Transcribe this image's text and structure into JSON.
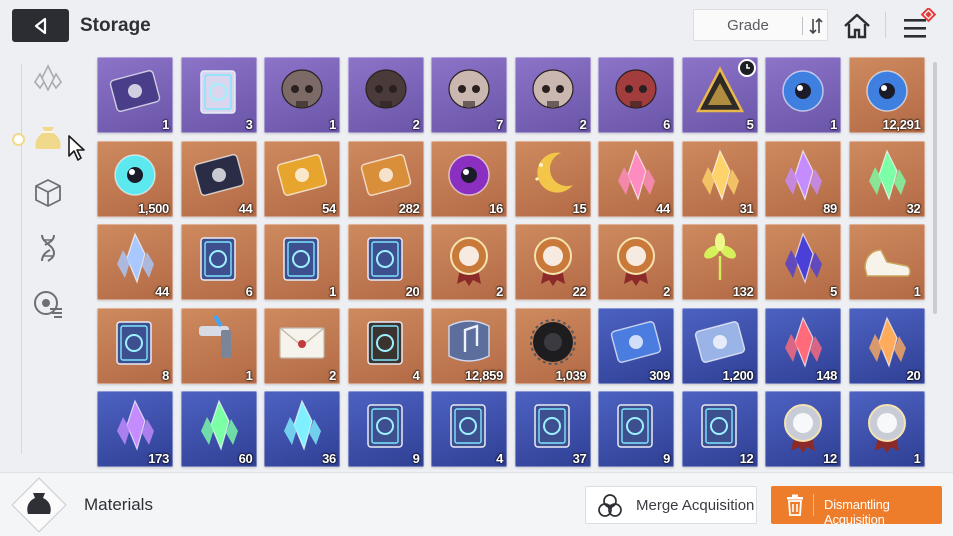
{
  "header": {
    "title": "Storage",
    "back_icon": "back-arrow-icon",
    "grade_label": "Grade",
    "sort_icon": "sort-arrows-icon",
    "home_icon": "home-icon",
    "menu_icon": "hamburger-menu-icon"
  },
  "sidebar": {
    "categories": [
      {
        "name": "crystal-category",
        "icon": "crystal-icon",
        "active": false
      },
      {
        "name": "materials-category",
        "icon": "pouch-icon",
        "active": true
      },
      {
        "name": "cube-category",
        "icon": "cube-icon",
        "active": false
      },
      {
        "name": "dna-category",
        "icon": "dna-icon",
        "active": false
      },
      {
        "name": "module-category",
        "icon": "disc-icon",
        "active": false
      }
    ]
  },
  "colors": {
    "purple": "#7a63b8",
    "orange": "#c17a52",
    "blue": "#3e51ab",
    "accent_orange": "#ee7d2b"
  },
  "items": [
    {
      "icon": "eye-card-icon",
      "grade": "purple",
      "count": "1"
    },
    {
      "icon": "blueprint-book-icon",
      "grade": "purple",
      "count": "3"
    },
    {
      "icon": "mech-head-icon",
      "grade": "purple",
      "count": "1"
    },
    {
      "icon": "brain-icon",
      "grade": "purple",
      "count": "2"
    },
    {
      "icon": "monster-skull-icon",
      "grade": "purple",
      "count": "7"
    },
    {
      "icon": "flesh-head-icon",
      "grade": "purple",
      "count": "2"
    },
    {
      "icon": "red-organ-icon",
      "grade": "purple",
      "count": "6"
    },
    {
      "icon": "pyramid-device-icon",
      "grade": "purple",
      "count": "5",
      "timer": true
    },
    {
      "icon": "eyeball-skull-icon",
      "grade": "purple",
      "count": "1"
    },
    {
      "icon": "blue-orb-creature-icon",
      "grade": "orange",
      "count": "12,291"
    },
    {
      "icon": "cyan-sphere-icon",
      "grade": "orange",
      "count": "1,500"
    },
    {
      "icon": "chip-module-icon",
      "grade": "orange",
      "count": "44"
    },
    {
      "icon": "gold-ticket-icon",
      "grade": "orange",
      "count": "54"
    },
    {
      "icon": "rainbow-ticket-icon",
      "grade": "orange",
      "count": "282"
    },
    {
      "icon": "purple-eye-orb-icon",
      "grade": "orange",
      "count": "16"
    },
    {
      "icon": "golden-moon-icon",
      "grade": "orange",
      "count": "15"
    },
    {
      "icon": "pink-crystal-icon",
      "grade": "orange",
      "count": "44"
    },
    {
      "icon": "rainbow-crystal-icon",
      "grade": "orange",
      "count": "31"
    },
    {
      "icon": "violet-crystal-icon",
      "grade": "orange",
      "count": "89"
    },
    {
      "icon": "green-crystal-icon",
      "grade": "orange",
      "count": "32"
    },
    {
      "icon": "blue-crystal-icon",
      "grade": "orange",
      "count": "44"
    },
    {
      "icon": "skill-book-x-icon",
      "grade": "orange",
      "count": "6"
    },
    {
      "icon": "skill-book-z-icon",
      "grade": "orange",
      "count": "1"
    },
    {
      "icon": "skill-book-ring-icon",
      "grade": "orange",
      "count": "20"
    },
    {
      "icon": "medal-shield-icon",
      "grade": "orange",
      "count": "2"
    },
    {
      "icon": "medal-sword-icon",
      "grade": "orange",
      "count": "22"
    },
    {
      "icon": "medal-target-icon",
      "grade": "orange",
      "count": "2"
    },
    {
      "icon": "green-sprout-icon",
      "grade": "orange",
      "count": "132"
    },
    {
      "icon": "dark-cube-crystal-icon",
      "grade": "orange",
      "count": "5"
    },
    {
      "icon": "white-shoes-icon",
      "grade": "orange",
      "count": "1"
    },
    {
      "icon": "star-tome-icon",
      "grade": "orange",
      "count": "8"
    },
    {
      "icon": "spray-gun-icon",
      "grade": "orange",
      "count": "1"
    },
    {
      "icon": "letter-envelope-icon",
      "grade": "orange",
      "count": "2"
    },
    {
      "icon": "dark-journal-icon",
      "grade": "orange",
      "count": "4"
    },
    {
      "icon": "music-scroll-icon",
      "grade": "orange",
      "count": "12,859"
    },
    {
      "icon": "black-flower-icon",
      "grade": "orange",
      "count": "1,039"
    },
    {
      "icon": "blue-ticket-icon",
      "grade": "blue",
      "count": "309"
    },
    {
      "icon": "silver-ticket-icon",
      "grade": "blue",
      "count": "1,200"
    },
    {
      "icon": "red-crystal-icon",
      "grade": "blue",
      "count": "148"
    },
    {
      "icon": "orange-crystal-icon",
      "grade": "blue",
      "count": "20"
    },
    {
      "icon": "purple-shard-icon",
      "grade": "blue",
      "count": "173"
    },
    {
      "icon": "green-shard-icon",
      "grade": "blue",
      "count": "60"
    },
    {
      "icon": "cyan-shard-icon",
      "grade": "blue",
      "count": "36"
    },
    {
      "icon": "blue-book-x-icon",
      "grade": "blue",
      "count": "9"
    },
    {
      "icon": "blue-book-shield-icon",
      "grade": "blue",
      "count": "4"
    },
    {
      "icon": "blue-book-z-icon",
      "grade": "blue",
      "count": "37"
    },
    {
      "icon": "blue-book-no-icon",
      "grade": "blue",
      "count": "9"
    },
    {
      "icon": "blue-book-ring-icon",
      "grade": "blue",
      "count": "12"
    },
    {
      "icon": "silver-medal-cross-icon",
      "grade": "blue",
      "count": "12"
    },
    {
      "icon": "silver-medal-shield-icon",
      "grade": "blue",
      "count": "1"
    }
  ],
  "footer": {
    "section_icon": "materials-pouch-icon",
    "section_label": "Materials",
    "merge_label": "Merge Acquisition",
    "merge_icon": "merge-icon",
    "dismantle_label": "Dismantling Acquisition",
    "dismantle_icon": "trash-icon"
  }
}
